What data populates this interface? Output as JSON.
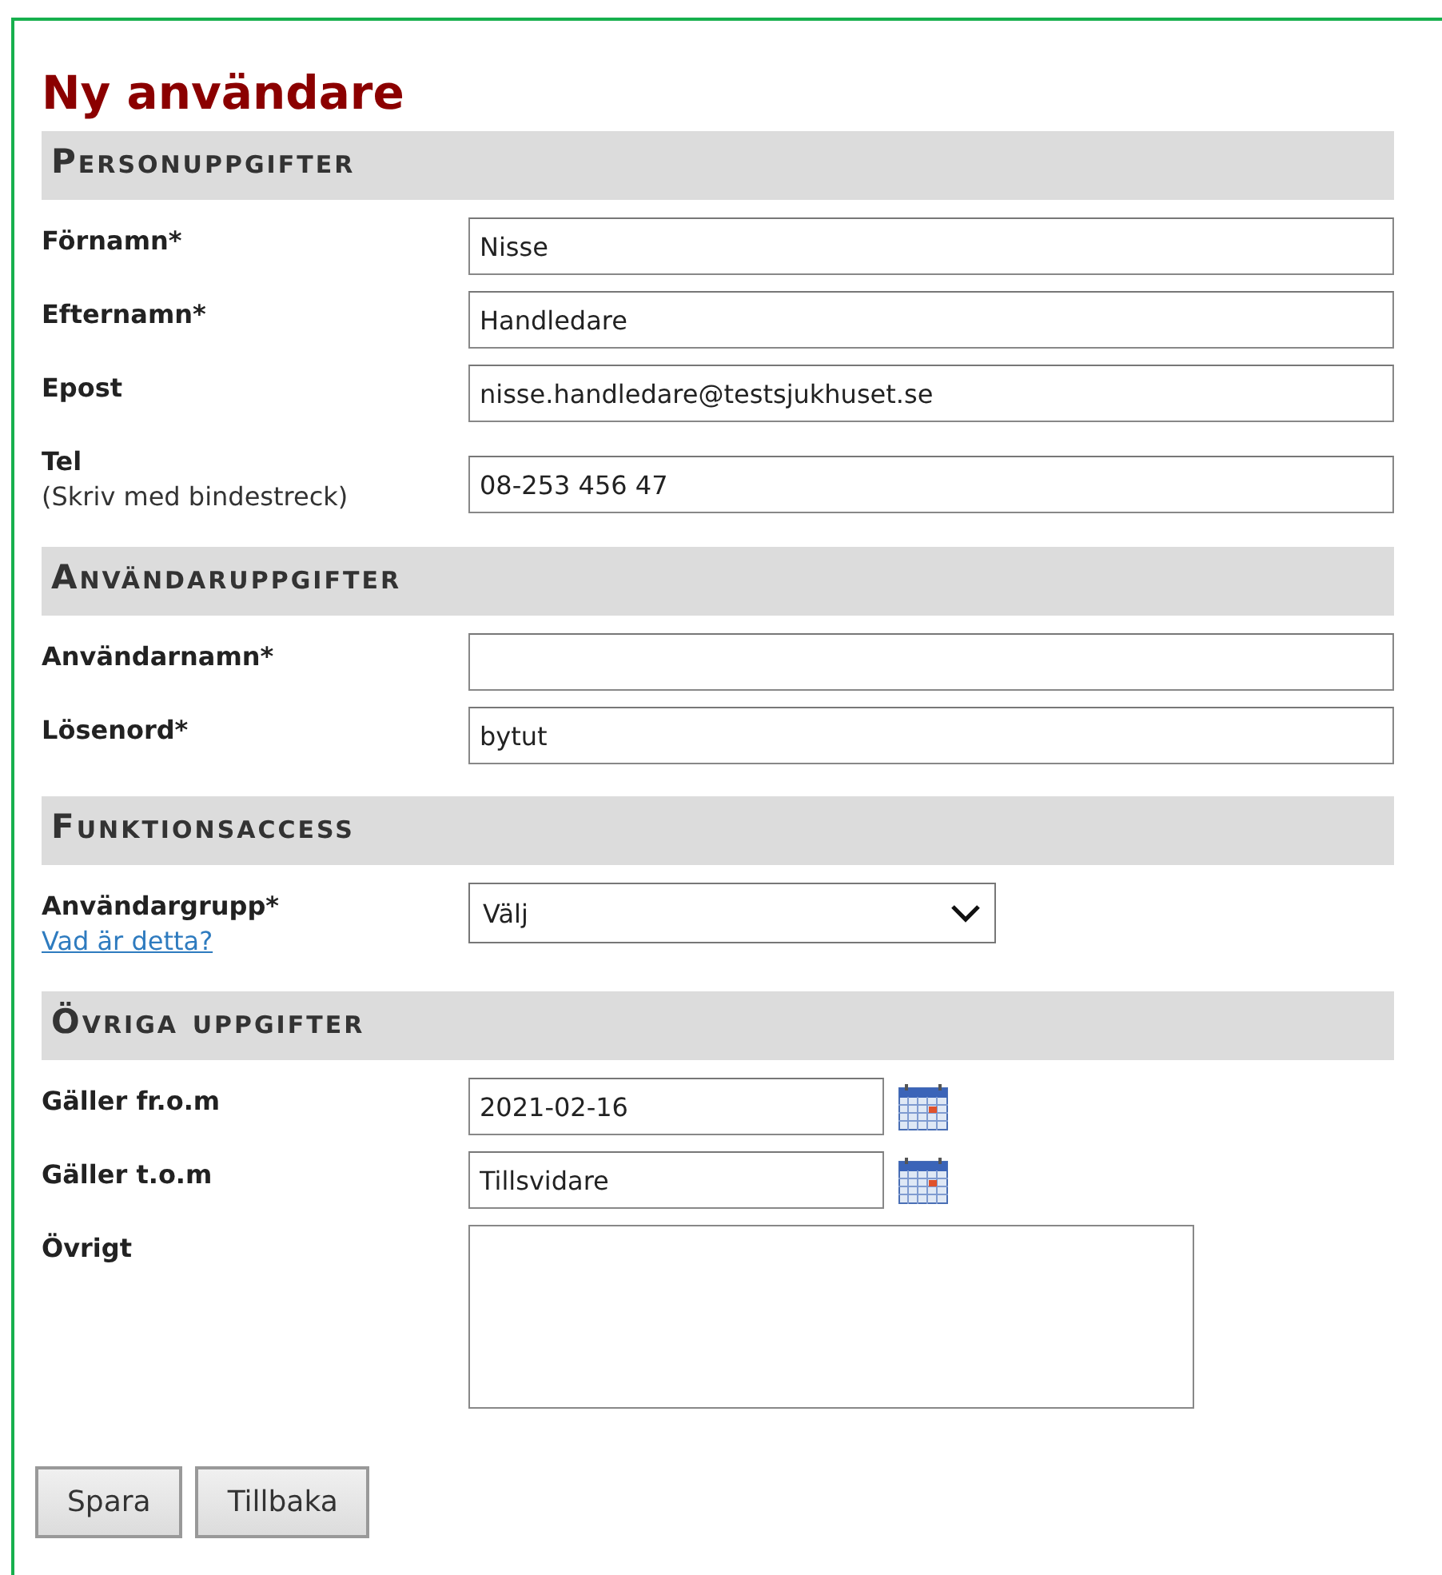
{
  "title": "Ny användare",
  "sections": [
    {
      "heading": "Personuppgifter",
      "fields": [
        {
          "label": "Förnamn*",
          "kind": "text",
          "value": "Nisse"
        },
        {
          "label": "Efternamn*",
          "kind": "text",
          "value": "Handledare"
        },
        {
          "label": "Epost",
          "kind": "text",
          "value": "nisse.handledare@testsjukhuset.se"
        },
        {
          "label": "Tel",
          "hint": "(Skriv med bindestreck)",
          "kind": "text",
          "value": "08-253 456 47"
        }
      ]
    },
    {
      "heading": "Användaruppgifter",
      "fields": [
        {
          "label": "Användarnamn*",
          "kind": "text"
        },
        {
          "label": "Lösenord*",
          "kind": "text",
          "value": "bytut"
        }
      ]
    },
    {
      "heading": "Funktionsaccess",
      "fields": [
        {
          "label": "Användargrupp*",
          "link": "Vad är detta?",
          "kind": "select",
          "value": "Välj"
        }
      ]
    },
    {
      "heading": "Övriga uppgifter",
      "fields": [
        {
          "label": "Gäller fr.o.m",
          "kind": "date",
          "value": "2021-02-16"
        },
        {
          "label": "Gäller t.o.m",
          "kind": "date",
          "value": "Tillsvidare"
        },
        {
          "label": "Övrigt",
          "kind": "textarea"
        }
      ]
    }
  ],
  "buttons": [
    "Spara",
    "Tillbaka"
  ]
}
